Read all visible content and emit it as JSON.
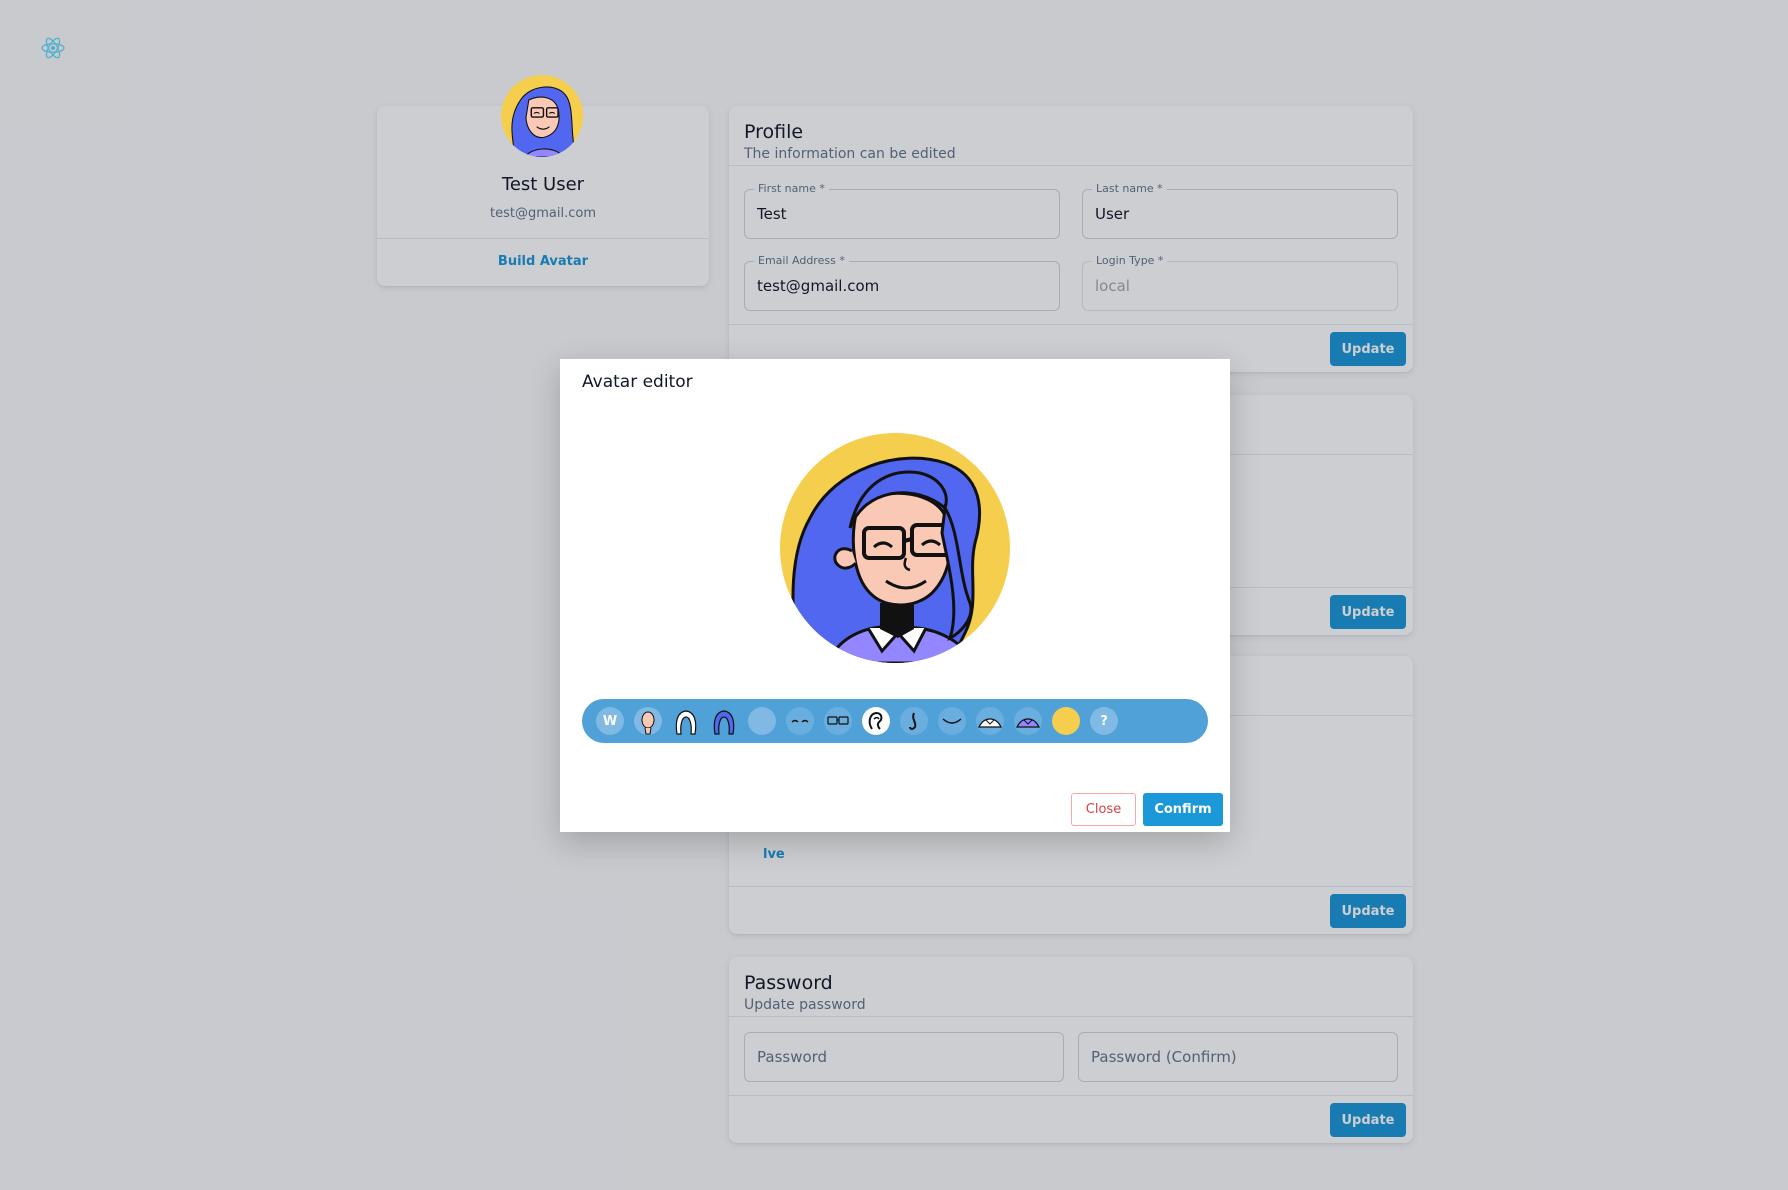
{
  "user": {
    "name": "Test User",
    "email": "test@gmail.com",
    "build_avatar_label": "Build Avatar"
  },
  "profile": {
    "title": "Profile",
    "subtitle": "The information can be edited",
    "first_name": {
      "label": "First name *",
      "value": "Test"
    },
    "last_name": {
      "label": "Last name *",
      "value": "User"
    },
    "email": {
      "label": "Email Address *",
      "value": "test@gmail.com"
    },
    "login_type": {
      "label": "Login Type *",
      "value": "local"
    },
    "update_label": "Update"
  },
  "card2": {
    "update_label": "Update"
  },
  "card3": {
    "partial_link": "lve",
    "update_label": "Update"
  },
  "password": {
    "title": "Password",
    "subtitle": "Update password",
    "password_placeholder": "Password",
    "confirm_placeholder": "Password (Confirm)",
    "update_label": "Update"
  },
  "modal": {
    "title": "Avatar editor",
    "toolbar": [
      {
        "name": "gender-tool",
        "text": "W"
      },
      {
        "name": "face-color-tool",
        "text": ""
      },
      {
        "name": "hair-style-tool",
        "text": ""
      },
      {
        "name": "hair-color-tool",
        "text": ""
      },
      {
        "name": "hat-tool",
        "text": ""
      },
      {
        "name": "eyes-tool",
        "text": ""
      },
      {
        "name": "glasses-tool",
        "text": ""
      },
      {
        "name": "ear-tool",
        "text": ""
      },
      {
        "name": "nose-tool",
        "text": ""
      },
      {
        "name": "mouth-tool",
        "text": ""
      },
      {
        "name": "shirt-style-tool",
        "text": ""
      },
      {
        "name": "shirt-color-tool",
        "text": ""
      },
      {
        "name": "bg-color-tool",
        "text": ""
      },
      {
        "name": "random-tool",
        "text": "?"
      }
    ],
    "close_label": "Close",
    "confirm_label": "Confirm"
  },
  "colors": {
    "accent": "#1a98d8",
    "avatar_bg": "#f5ce4d",
    "hair": "#5167ef",
    "skin": "#f9c9b6",
    "shirt": "#9287ff",
    "toolbar": "#4fa1d8",
    "close_red": "#d14343"
  }
}
